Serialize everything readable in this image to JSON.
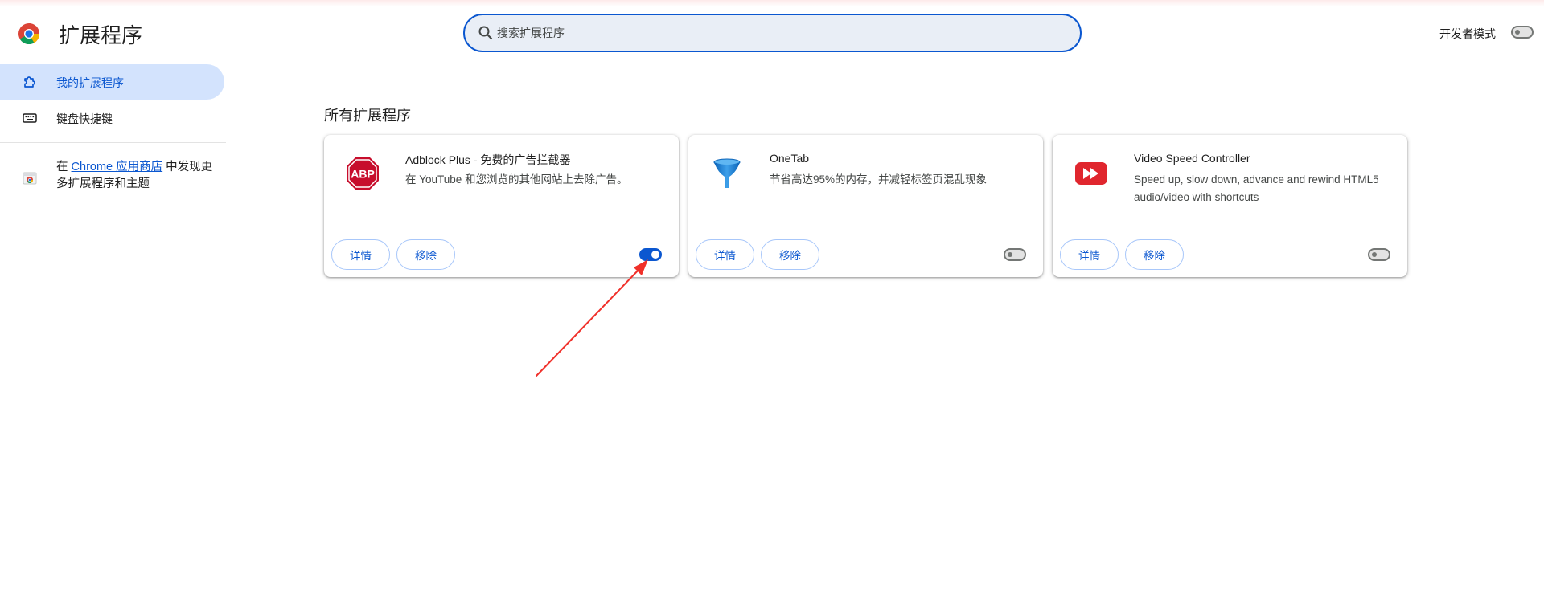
{
  "header": {
    "title": "扩展程序",
    "search_placeholder": "搜索扩展程序",
    "developer_mode_label": "开发者模式",
    "developer_mode_on": false
  },
  "sidebar": {
    "items": [
      {
        "label": "我的扩展程序",
        "icon": "puzzle-icon",
        "active": true
      },
      {
        "label": "键盘快捷键",
        "icon": "keyboard-icon",
        "active": false
      }
    ],
    "store_prefix": "在 ",
    "store_link": "Chrome 应用商店",
    "store_suffix": " 中发现更多扩展程序和主题"
  },
  "main": {
    "section_title": "所有扩展程序",
    "details_label": "详情",
    "remove_label": "移除",
    "extensions": [
      {
        "name": "Adblock Plus - 免费的广告拦截器",
        "description": "在 YouTube 和您浏览的其他网站上去除广告。",
        "icon": "abp-icon",
        "enabled": true
      },
      {
        "name": "OneTab",
        "description": "节省高达95%的内存，并减轻标签页混乱现象",
        "icon": "funnel-icon",
        "enabled": false
      },
      {
        "name": "Video Speed Controller",
        "description": "Speed up, slow down, advance and rewind HTML5 audio/video with shortcuts",
        "icon": "fast-forward-icon",
        "enabled": false
      }
    ]
  },
  "colors": {
    "accent": "#0b57d0",
    "active_nav_bg": "#d3e3fd",
    "search_bg": "#e9eef6",
    "annotation_arrow": "#f0302a"
  }
}
